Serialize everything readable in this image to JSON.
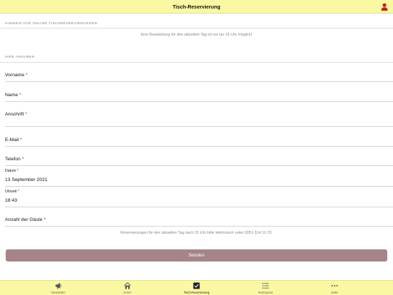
{
  "header": {
    "title": "Tisch-Reservierung"
  },
  "sections": {
    "hinweis_title": "HINWEIS FÜR ONLINE TISCHRESERVIERUNGEN:",
    "hinweis_text": "Eine Bearbeitung für den aktuellen Tag ist nur bis 15 Uhr möglich!",
    "angaben_title": "IHRE ANGABEN"
  },
  "form": {
    "vorname_label": "Vorname",
    "name_label": "Name",
    "anschrift_label": "Anschrift",
    "email_label": "E-Mail",
    "telefon_label": "Telefon",
    "datum_label": "Datum",
    "datum_value": "13 September 2021",
    "uhrzeit_label": "Uhrzeit",
    "uhrzeit_value": "18:43",
    "gaeste_label": "Anzahl der Gäste",
    "required_mark": "*",
    "footer_note": "Reservierungen für den aktuellen Tag nach 15 Uhr bitte telefonisch unter 0351-314 10 23.",
    "send_label": "Senden"
  },
  "tabbar": {
    "items": [
      {
        "label": "Newsletter",
        "icon": "megaphone-icon"
      },
      {
        "label": "Home",
        "icon": "home-icon"
      },
      {
        "label": "Tisch-Reservierung",
        "icon": "checkbox-icon"
      },
      {
        "label": "Restaurant",
        "icon": "list-icon"
      },
      {
        "label": "Mehr",
        "icon": "more-icon"
      }
    ]
  },
  "colors": {
    "bar_background": "#fbf8a4",
    "button": "#a5858a",
    "required": "#d01010",
    "user_icon": "#c81e1e"
  }
}
